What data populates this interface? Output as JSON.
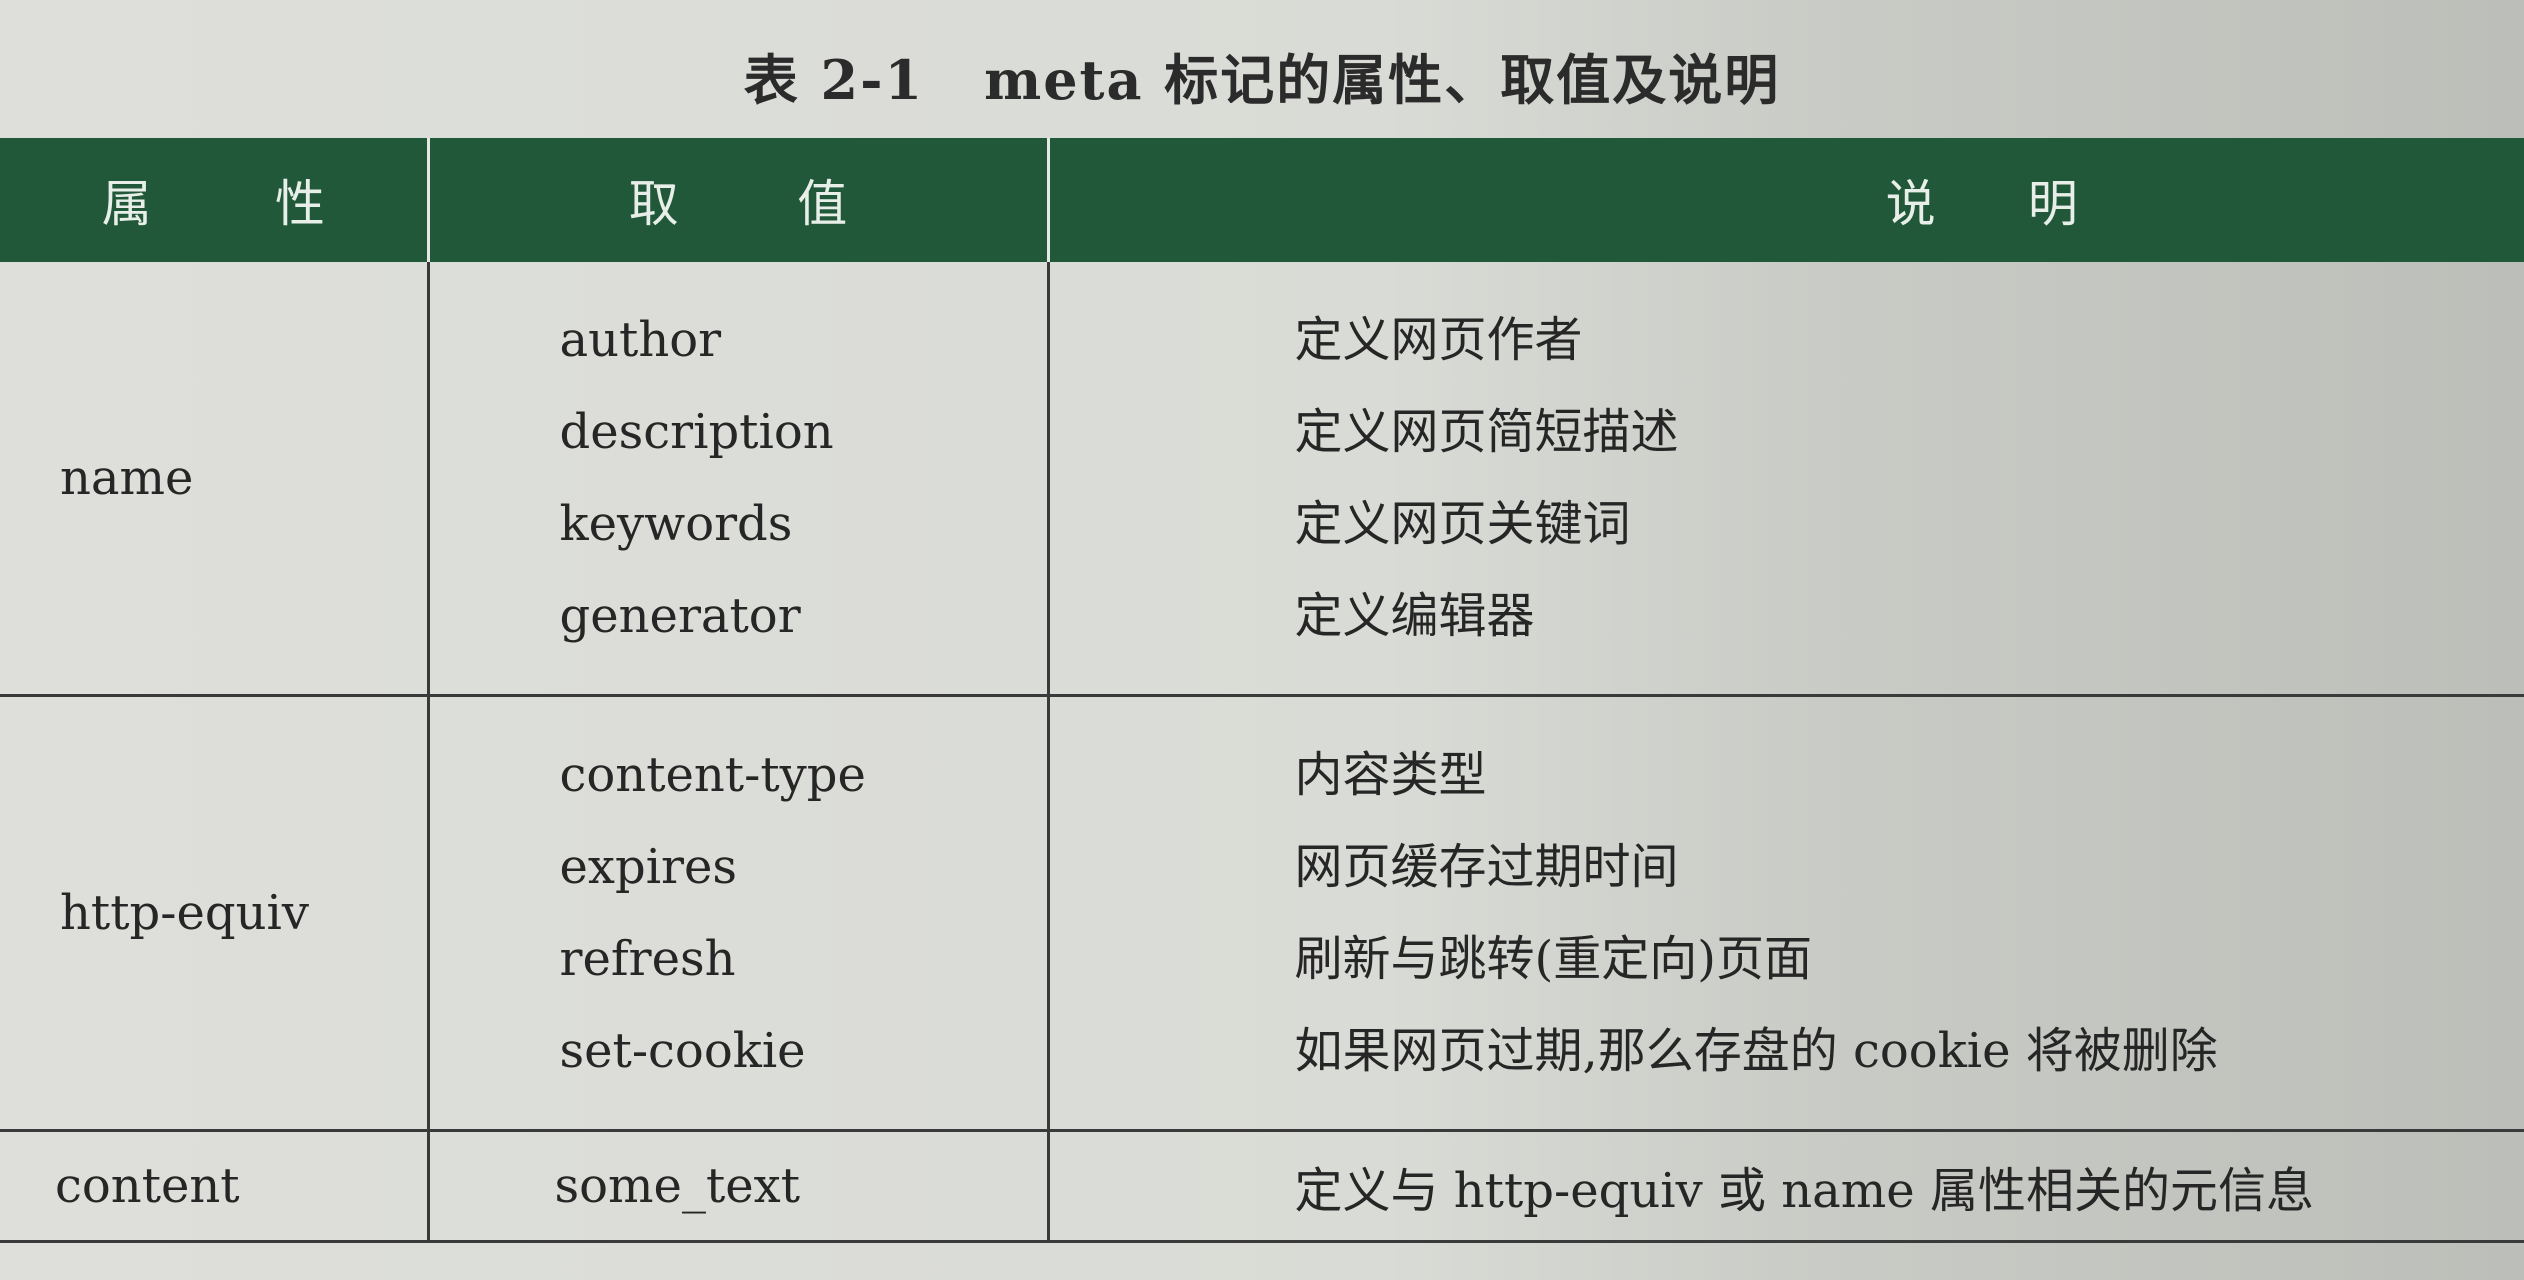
{
  "caption": {
    "number": "表 2-1",
    "title": "meta 标记的属性、取值及说明"
  },
  "header": [
    "属  性",
    "取  值",
    "说  明"
  ],
  "header_chars": [
    [
      "属",
      "性"
    ],
    [
      "取",
      "值"
    ],
    [
      "说",
      "明"
    ]
  ],
  "rows": [
    {
      "attribute": "name",
      "values": [
        "author",
        "description",
        "keywords",
        "generator"
      ],
      "descriptions": [
        "定义网页作者",
        "定义网页简短描述",
        "定义网页关键词",
        "定义编辑器"
      ]
    },
    {
      "attribute": "http-equiv",
      "values": [
        "content-type",
        "expires",
        "refresh",
        "set-cookie"
      ],
      "descriptions": [
        "内容类型",
        "网页缓存过期时间",
        "刷新与跳转(重定向)页面",
        "如果网页过期,那么存盘的 cookie 将被删除"
      ]
    },
    {
      "attribute": "content",
      "values": [
        "some_text"
      ],
      "descriptions": [
        "定义与 http-equiv 或 name 属性相关的元信息"
      ]
    }
  ],
  "colors": {
    "header_bg": "#22583a",
    "header_text": "#e8efe8",
    "paper": "#dcddd9"
  }
}
